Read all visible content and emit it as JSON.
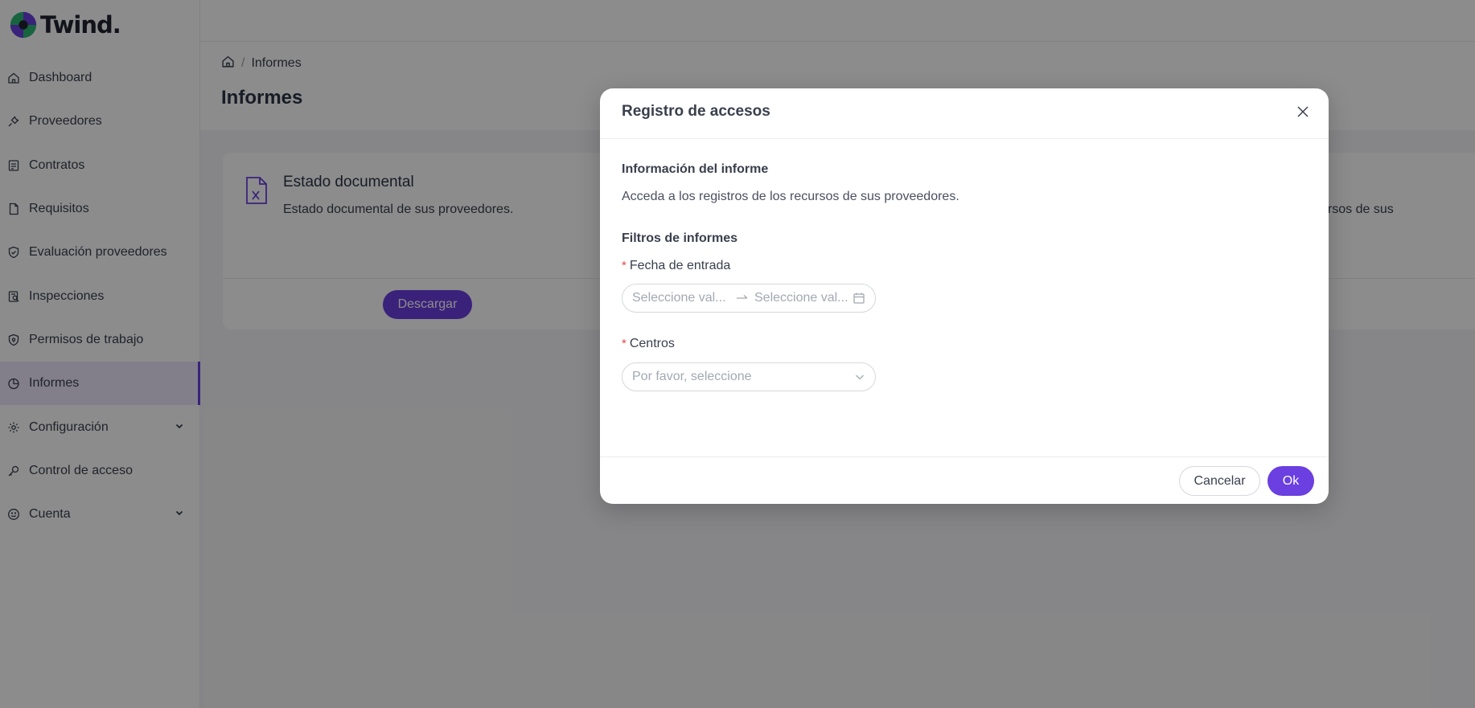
{
  "app": {
    "name": "Twind."
  },
  "sidebar": {
    "items": [
      {
        "label": "Dashboard",
        "icon": "home-icon"
      },
      {
        "label": "Proveedores",
        "icon": "plug-icon"
      },
      {
        "label": "Contratos",
        "icon": "contract-icon"
      },
      {
        "label": "Requisitos",
        "icon": "file-icon"
      },
      {
        "label": "Evaluación proveedores",
        "icon": "shield-check-icon"
      },
      {
        "label": "Inspecciones",
        "icon": "inspection-icon"
      },
      {
        "label": "Permisos de trabajo",
        "icon": "shield-icon"
      },
      {
        "label": "Informes",
        "icon": "pie-chart-icon",
        "active": true
      },
      {
        "label": "Configuración",
        "icon": "gear-icon",
        "expandable": true
      },
      {
        "label": "Control de acceso",
        "icon": "key-icon"
      },
      {
        "label": "Cuenta",
        "icon": "smile-icon",
        "expandable": true
      }
    ]
  },
  "breadcrumb": {
    "current": "Informes",
    "separator": "/"
  },
  "page": {
    "title": "Informes"
  },
  "card": {
    "title": "Estado documental",
    "description": "Estado documental de sus proveedores.",
    "download_label": "Descargar",
    "right_partial_text": "ursos de sus"
  },
  "modal": {
    "title": "Registro de accesos",
    "section_info_title": "Información del informe",
    "section_info_desc": "Acceda a los registros de los recursos de sus proveedores.",
    "section_filters_title": "Filtros de informes",
    "fecha_label": "Fecha de entrada",
    "fecha_start_placeholder": "Seleccione val...",
    "fecha_end_placeholder": "Seleccione val...",
    "centros_label": "Centros",
    "centros_placeholder": "Por favor, seleccione",
    "required_mark": "*",
    "cancel_label": "Cancelar",
    "ok_label": "Ok"
  },
  "colors": {
    "accent": "#6b3fe0",
    "required": "#e04848"
  }
}
